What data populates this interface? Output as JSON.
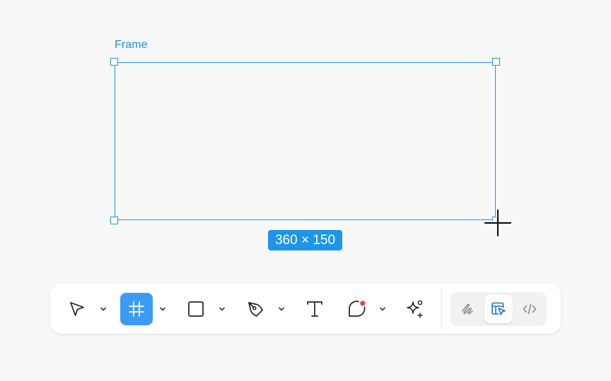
{
  "canvas": {
    "frame_label": "Frame",
    "size_label": "360 × 150"
  },
  "toolbar": {
    "tools": [
      {
        "name": "move",
        "icon": "pointer-arrow-icon",
        "has_menu": true,
        "active": false
      },
      {
        "name": "frame",
        "icon": "frame-hash-icon",
        "has_menu": true,
        "active": true
      },
      {
        "name": "shape",
        "icon": "rectangle-icon",
        "has_menu": true,
        "active": false
      },
      {
        "name": "pen",
        "icon": "pen-nib-icon",
        "has_menu": true,
        "active": false
      },
      {
        "name": "text",
        "icon": "text-t-icon",
        "has_menu": false,
        "active": false
      },
      {
        "name": "comment",
        "icon": "comment-bubble-icon",
        "has_menu": true,
        "active": false
      },
      {
        "name": "ai",
        "icon": "sparkle-ai-icon",
        "has_menu": false,
        "active": false
      }
    ],
    "modes": [
      {
        "name": "draw",
        "icon": "scribble-draw-icon",
        "active": false
      },
      {
        "name": "design",
        "icon": "design-cursor-icon",
        "active": true
      },
      {
        "name": "dev",
        "icon": "code-brackets-icon",
        "active": false
      }
    ]
  },
  "colors": {
    "accent": "#1e95ea",
    "active_tool": "#3b9bf5",
    "comment_dot": "#e5483c",
    "background": "#f8f8f8"
  }
}
